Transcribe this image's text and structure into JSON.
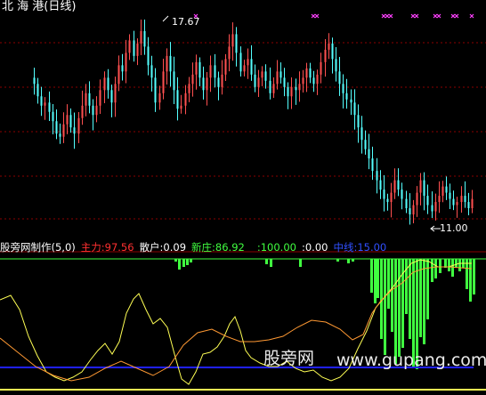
{
  "header": {
    "title": "北 海 港(日线)"
  },
  "price_panel": {
    "high_label": "17.67",
    "low_label": "11.00"
  },
  "indicator": {
    "name": "股旁网制作(5,0)",
    "zhuli": "主力:97.56",
    "sanhu": "散户:0.09",
    "xinzhuang": "新庄:86.92",
    "v100": ":100.00",
    "v0": ":0.00",
    "zhongxian": "中线:15.00"
  },
  "watermark": {
    "cn": "股旁网",
    "url": "www.gupang.com"
  },
  "colors": {
    "up": "#ff5050",
    "down": "#54ffff",
    "marker": "#ff40ff",
    "grid": "#8b0000",
    "bar_green": "#40ff40",
    "yellow": "#ffff54",
    "orange": "#ff9933",
    "blue": "#2020ff",
    "zhuli": "#ff3030",
    "sanhu": "#ffffff",
    "xinzhuang": "#40ff40",
    "v100": "#40ff40",
    "v0": "#ffffff",
    "zhongxian": "#3050ff"
  },
  "chart_data": {
    "type": "candlestick",
    "price_max": 17.67,
    "price_min": 11.0,
    "closes": [
      15.6,
      15.2,
      14.9,
      15.0,
      14.7,
      14.4,
      14.0,
      13.9,
      14.3,
      14.6,
      14.2,
      14.0,
      14.5,
      14.9,
      15.3,
      14.9,
      14.6,
      14.9,
      15.4,
      15.8,
      15.4,
      15.0,
      15.6,
      16.2,
      16.0,
      16.6,
      17.0,
      16.5,
      16.9,
      17.3,
      16.8,
      16.2,
      15.8,
      15.0,
      15.3,
      16.0,
      16.5,
      16.0,
      15.4,
      14.8,
      14.9,
      15.3,
      15.6,
      15.9,
      16.3,
      15.8,
      15.4,
      15.8,
      16.2,
      15.8,
      15.5,
      15.9,
      16.4,
      16.8,
      17.2,
      16.6,
      16.0,
      16.2,
      16.4,
      15.9,
      15.5,
      15.8,
      16.0,
      15.7,
      15.3,
      15.6,
      16.0,
      15.8,
      15.5,
      15.2,
      15.5,
      15.4,
      15.6,
      15.8,
      16.1,
      15.8,
      15.6,
      15.9,
      16.3,
      16.7,
      16.9,
      16.4,
      16.0,
      15.6,
      15.3,
      15.1,
      15.0,
      14.6,
      14.2,
      13.8,
      13.5,
      13.2,
      12.8,
      12.5,
      12.2,
      11.9,
      11.8,
      12.1,
      12.5,
      12.2,
      11.9,
      11.6,
      11.4,
      11.7,
      12.1,
      12.5,
      12.0,
      11.7,
      11.5,
      11.8,
      12.0,
      12.3,
      12.1,
      11.9,
      11.7,
      11.8,
      12.0,
      11.8,
      11.6,
      11.9
    ],
    "markers_x_index": [
      44,
      76,
      77,
      95,
      96,
      97,
      103,
      104,
      109,
      110,
      114,
      115,
      119
    ]
  }
}
